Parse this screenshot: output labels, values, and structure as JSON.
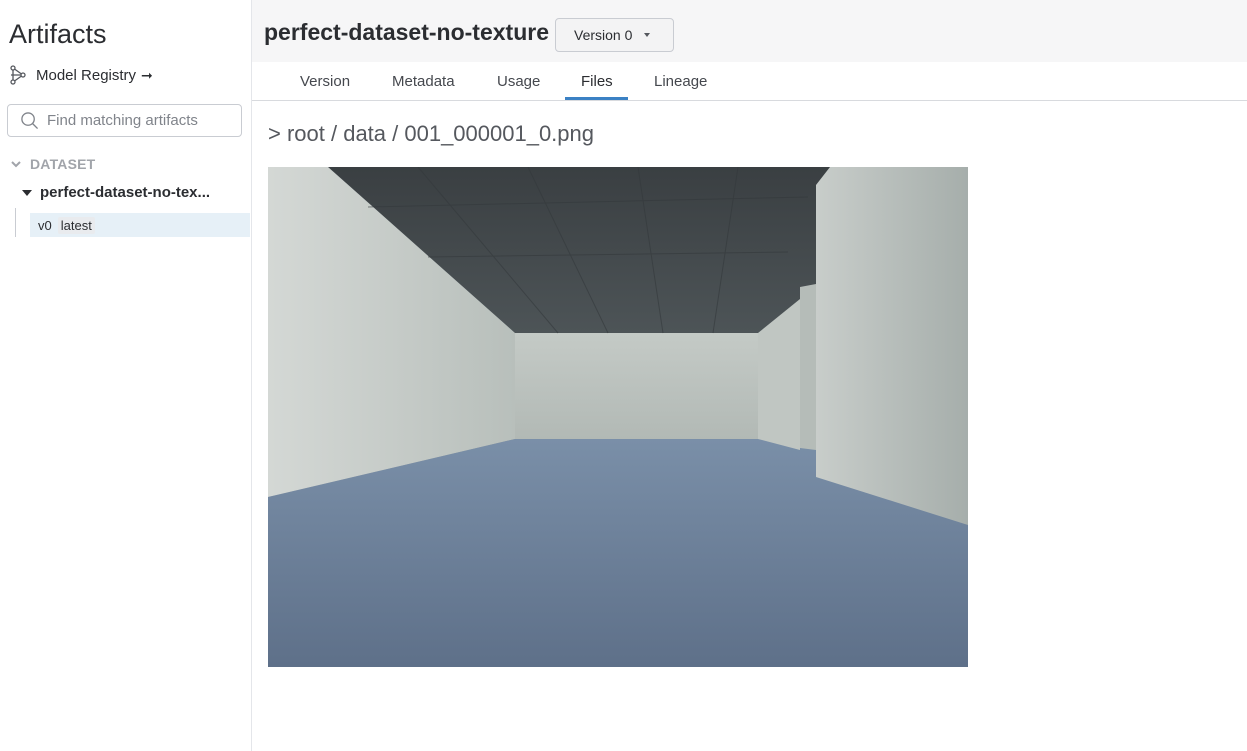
{
  "sidebar": {
    "title": "Artifacts",
    "registry_label": "Model Registry",
    "registry_arrow": "➞",
    "search": {
      "placeholder": "Find matching artifacts"
    },
    "section_label": "DATASET",
    "artifact_name": "perfect-dataset-no-tex...",
    "version": {
      "label": "v0",
      "alias": "latest"
    }
  },
  "header": {
    "title": "perfect-dataset-no-texture",
    "version_select": "Version 0"
  },
  "tabs": [
    {
      "label": "Version"
    },
    {
      "label": "Metadata"
    },
    {
      "label": "Usage"
    },
    {
      "label": "Files",
      "active": true
    },
    {
      "label": "Lineage"
    }
  ],
  "content": {
    "breadcrumb": "> root / data / 001_000001_0.png"
  },
  "colors": {
    "accent": "#3b81c4",
    "selected_row": "#e6f0f7",
    "floor": "#6a7f99",
    "ceiling": "#3f4548",
    "wall": "#c9cfcb"
  }
}
